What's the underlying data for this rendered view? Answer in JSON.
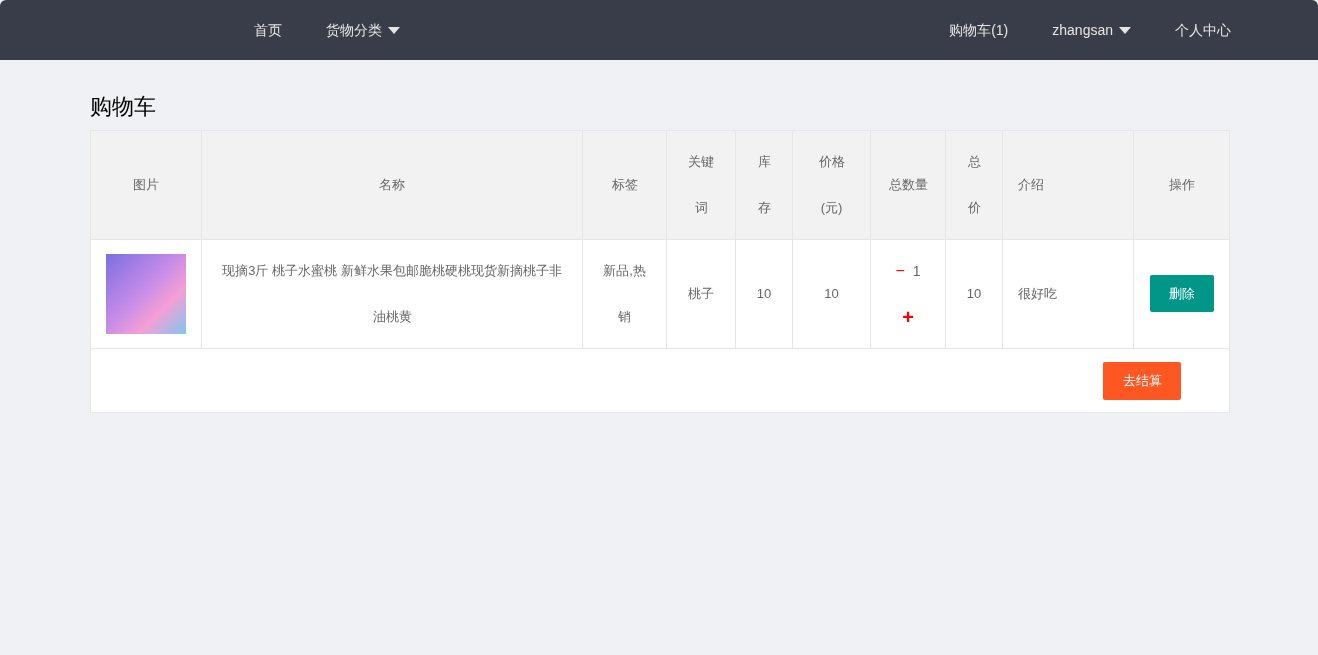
{
  "navbar": {
    "left": [
      {
        "label": "首页",
        "dropdown": false
      },
      {
        "label": "货物分类",
        "dropdown": true
      }
    ],
    "right": [
      {
        "label": "购物车(1)",
        "dropdown": false
      },
      {
        "label": "zhangsan",
        "dropdown": true
      },
      {
        "label": "个人中心",
        "dropdown": false
      }
    ]
  },
  "page_title": "购物车",
  "table": {
    "columns": [
      "图片",
      "名称",
      "标签",
      "关键词",
      "库存",
      "价格(元)",
      "总数量",
      "总价",
      "介绍",
      "操作"
    ],
    "rows": [
      {
        "name": "现摘3斤 桃子水蜜桃 新鲜水果包邮脆桃硬桃现货新摘桃子非油桃黄",
        "tags": "新品,热销",
        "keyword": "桃子",
        "stock": "10",
        "price": "10",
        "decrease": "−",
        "quantity": "1",
        "increase": "+",
        "total": "10",
        "description": "很好吃",
        "action": "删除"
      }
    ]
  },
  "checkout_button": "去结算"
}
